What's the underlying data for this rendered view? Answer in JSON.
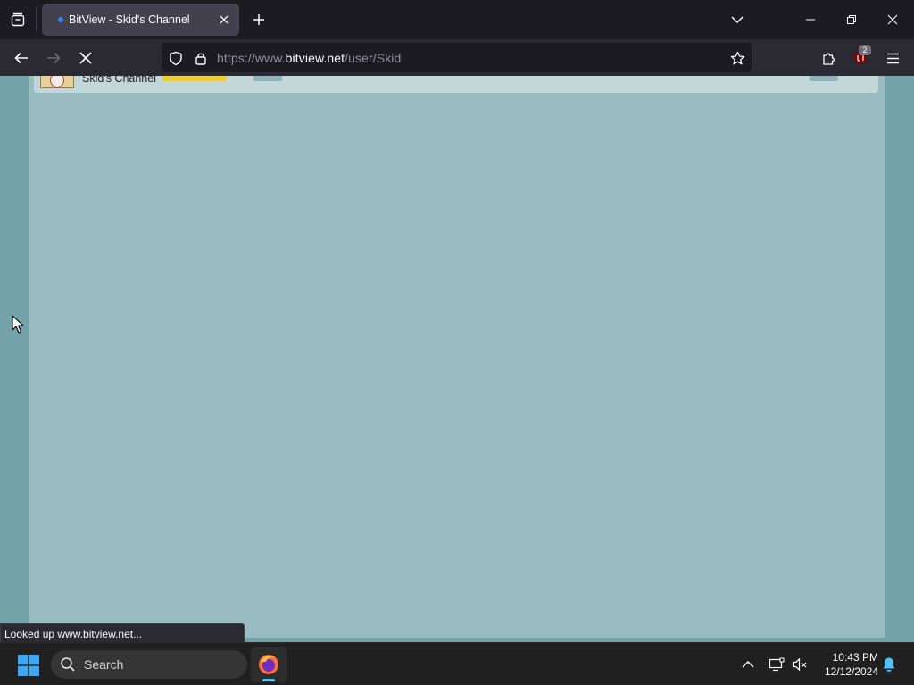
{
  "browser": {
    "tab": {
      "title": "BitView - Skid's Channel"
    },
    "url": {
      "prefix": "https://www.",
      "domain": "bitview.net",
      "path": "/user/Skid"
    },
    "extension_badge": "2",
    "status_text": "Looked up www.bitview.net..."
  },
  "page": {
    "channel_name": "Skid's Channel"
  },
  "taskbar": {
    "search_label": "Search",
    "time": "10:43 PM",
    "date": "12/12/2024"
  },
  "colors": {
    "page_background": "#73a3a8",
    "content_panel": "#98bcc0",
    "subscribe_button": "#f2cd27",
    "browser_frame": "#1c1b22",
    "toolbar": "#2b2a33"
  },
  "icons": {
    "tab_list": "tab-list-icon",
    "new_tab": "plus-icon",
    "close_tab": "close-icon",
    "back": "back-arrow-icon",
    "forward": "forward-arrow-icon",
    "stop": "stop-loading-icon",
    "tracking_protection": "shield-icon",
    "secure": "lock-icon",
    "bookmark": "star-icon",
    "extensions": "puzzle-icon",
    "ublock": "ublock-icon",
    "menu": "hamburger-icon"
  }
}
